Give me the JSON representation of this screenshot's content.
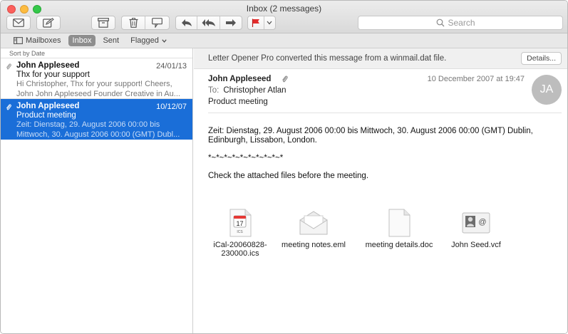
{
  "window": {
    "title": "Inbox (2 messages)"
  },
  "toolbar": {
    "search_placeholder": "Search"
  },
  "favorites": {
    "mailboxes": "Mailboxes",
    "inbox": "Inbox",
    "sent": "Sent",
    "flagged": "Flagged"
  },
  "list": {
    "sort_label": "Sort by Date",
    "messages": [
      {
        "from": "John Appleseed",
        "date": "24/01/13",
        "subject": "Thx for your support",
        "preview1": "Hi Christopher, Thx for your support! Cheers,",
        "preview2": "John John Appleseed Founder Creative in Au..."
      },
      {
        "from": "John Appleseed",
        "date": "10/12/07",
        "subject": "Product meeting",
        "preview1": "Zeit: Dienstag, 29. August 2006 00:00 bis",
        "preview2": "Mittwoch, 30. August 2006 00:00 (GMT) Dubl..."
      }
    ]
  },
  "pane": {
    "banner": "Letter Opener Pro converted this message from a winmail.dat file.",
    "details_label": "Details...",
    "from": "John Appleseed",
    "date": "10 December 2007 at 19:47",
    "to_label": "To:",
    "to": "Christopher Atlan",
    "subject": "Product meeting",
    "avatar_initials": "JA",
    "body": [
      "Zeit: Dienstag, 29. August 2006 00:00 bis Mittwoch, 30. August 2006 00:00 (GMT) Dublin, Edinburgh, Lissabon, London.",
      "*~*~*~*~*~*~*~*~*~*",
      "Check the attached files before the meeting."
    ],
    "attachments": [
      {
        "name1": "iCal-20060828-",
        "name2": "230000.ics",
        "icon": "calendar-icon",
        "cal_day": "17",
        "cal_tag": "ICS"
      },
      {
        "name1": "meeting notes.eml",
        "name2": "",
        "icon": "envelope-icon"
      },
      {
        "name1": "meeting details.doc",
        "name2": "",
        "icon": "document-icon"
      },
      {
        "name1": "John Seed.vcf",
        "name2": "",
        "icon": "vcard-icon"
      }
    ]
  },
  "colors": {
    "selection": "#1a6ed8",
    "flag": "#e22b2b"
  }
}
